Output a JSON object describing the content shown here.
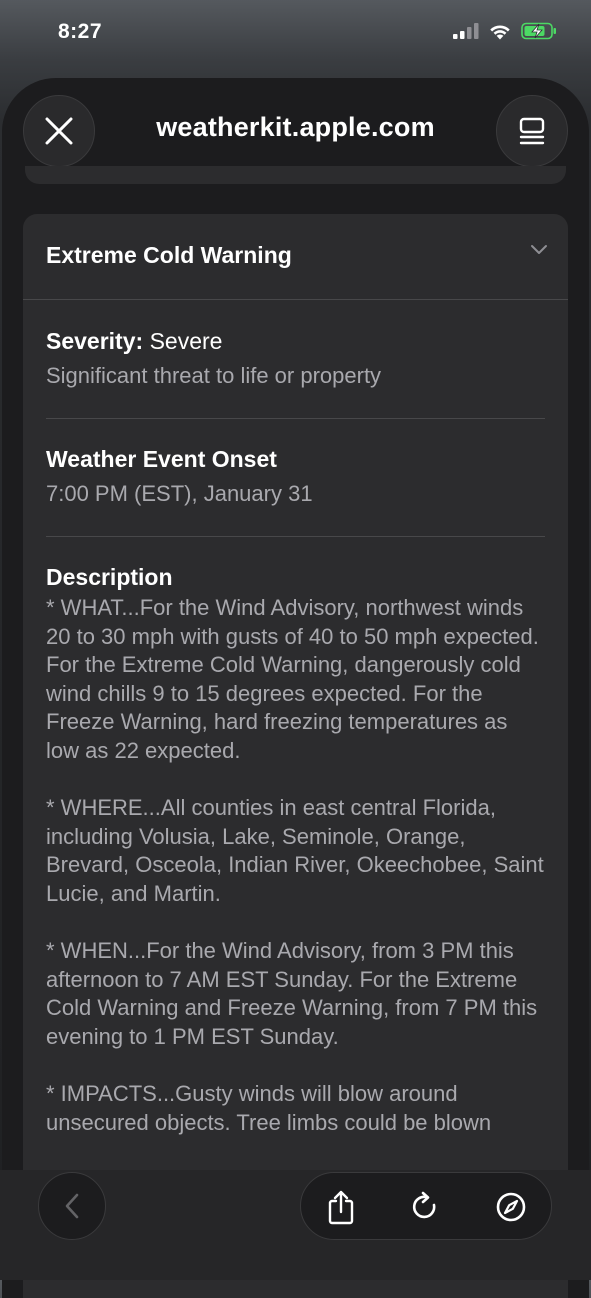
{
  "status_bar": {
    "time": "8:27"
  },
  "header": {
    "url": "weatherkit.apple.com"
  },
  "alert": {
    "title": "Extreme Cold Warning",
    "severity_label": "Severity:",
    "severity_value": "Severe",
    "severity_description": "Significant threat to life or property",
    "onset_label": "Weather Event Onset",
    "onset_value": "7:00 PM (EST), January 31",
    "description_label": "Description",
    "description_text": "* WHAT...For the Wind Advisory, northwest winds 20 to 30 mph with gusts of 40 to 50 mph expected. For the Extreme Cold Warning, dangerously cold wind chills 9 to 15 degrees expected. For the Freeze Warning, hard freezing temperatures as low as 22 expected.\n\n* WHERE...All counties in east central Florida, including Volusia, Lake, Seminole, Orange, Brevard, Osceola, Indian River, Okeechobee, Saint Lucie, and Martin.\n\n* WHEN...For the Wind Advisory, from 3 PM this afternoon to 7 AM EST Sunday. For the Extreme Cold Warning and Freeze Warning, from 7 PM this evening to 1 PM EST Sunday.\n\n* IMPACTS...Gusty winds will blow around unsecured objects. Tree limbs could be blown"
  },
  "icons": {
    "close": "close-icon",
    "reader": "reader-icon",
    "chevron": "chevron-down-icon",
    "back": "back-icon",
    "share": "share-icon",
    "reload": "reload-icon",
    "safari": "compass-icon"
  },
  "colors": {
    "sheet_bg": "#1c1c1e",
    "card_bg": "#2c2c2e",
    "secondary_text": "#a9a9ae",
    "battery_green": "#4cd964"
  }
}
